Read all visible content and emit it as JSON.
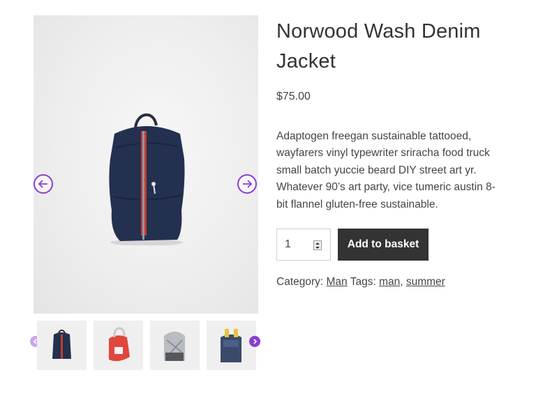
{
  "product": {
    "title": "Norwood Wash Denim Jacket",
    "price": "$75.00",
    "description": "Adaptogen freegan sustainable tattooed, wayfarers vinyl typewriter sriracha food truck small batch yuccie beard DIY street art yr. Whatever 90’s art party, vice tumeric austin 8-bit flannel gluten-free sustainable.",
    "quantity": "1",
    "add_button_label": "Add to basket"
  },
  "meta": {
    "category_label": "Category:",
    "category": "Man",
    "tags_label": "Tags:",
    "tag_1": "man",
    "separator": ",",
    "tag_2": "summer"
  },
  "gallery": {
    "prev_icon": "arrow-left-circle-icon",
    "next_icon": "arrow-right-circle-icon",
    "thumbnails": [
      "navy-drawstring-backpack",
      "red-white-backpack",
      "silver-backpack",
      "navy-yellow-backpack"
    ]
  },
  "colors": {
    "accent": "#8a3fd1",
    "button": "#333333",
    "text": "#43454b"
  }
}
